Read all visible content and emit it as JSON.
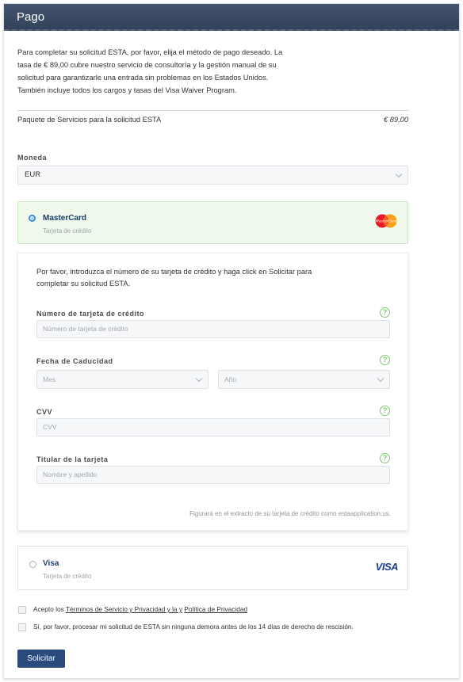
{
  "header": {
    "title": "Pago"
  },
  "intro": {
    "text": "Para completar su solicitud ESTA, por favor, elija el método de pago deseado. La tasa de € 89,00 cubre nuestro servicio de consultoría y la gestión manual de su solicitud para garantizarle una entrada sin problemas en los Estados Unidos. También incluye todos los cargos y tasas del Visa Waiver Program."
  },
  "package": {
    "label": "Paquete de Servicios para la solicitud ESTA",
    "price": "€ 89,00"
  },
  "currency": {
    "label": "Moneda",
    "value": "EUR"
  },
  "payment_options": [
    {
      "title": "MasterCard",
      "subtitle": "Tarjeta de crédito",
      "selected": true,
      "logo": "mastercard-logo"
    },
    {
      "title": "Visa",
      "subtitle": "Tarjeta de crédito",
      "selected": false,
      "logo": "VISA"
    }
  ],
  "card_form": {
    "instructions": "Por favor, introduzca el número de su tarjeta de crédito y haga click en Solicitar para completar su solicitud ESTA.",
    "card_number": {
      "label": "Número de tarjeta de crédito",
      "placeholder": "Número de tarjeta de crédito"
    },
    "expiry": {
      "label": "Fecha de Caducidad",
      "month_placeholder": "Mes",
      "year_placeholder": "Año"
    },
    "cvv": {
      "label": "CVV",
      "placeholder": "CVV"
    },
    "holder": {
      "label": "Titular de la tarjeta",
      "placeholder": "Nombre y apellido"
    },
    "help_icon": "?",
    "statement_note": "Figurará en el extracto de su tarjeta de crédito como estaapplication.us."
  },
  "consents": {
    "terms_prefix": "Acepto los ",
    "terms_link": "Términos de Servicio y Privacidad y la y",
    "terms_space": " ",
    "privacy_link": "Política de Privacidad",
    "waiver": "Sí, por favor, procesar mi solicitud de ESTA sin ninguna demora antes de los 14 días de derecho de rescisión."
  },
  "submit_label": "Solicitar",
  "colors": {
    "header": "#3b4a63",
    "selected_bg": "#eef9ec",
    "help": "#7cc66f",
    "button": "#2a4b7c",
    "radio": "#3b8fd9"
  }
}
